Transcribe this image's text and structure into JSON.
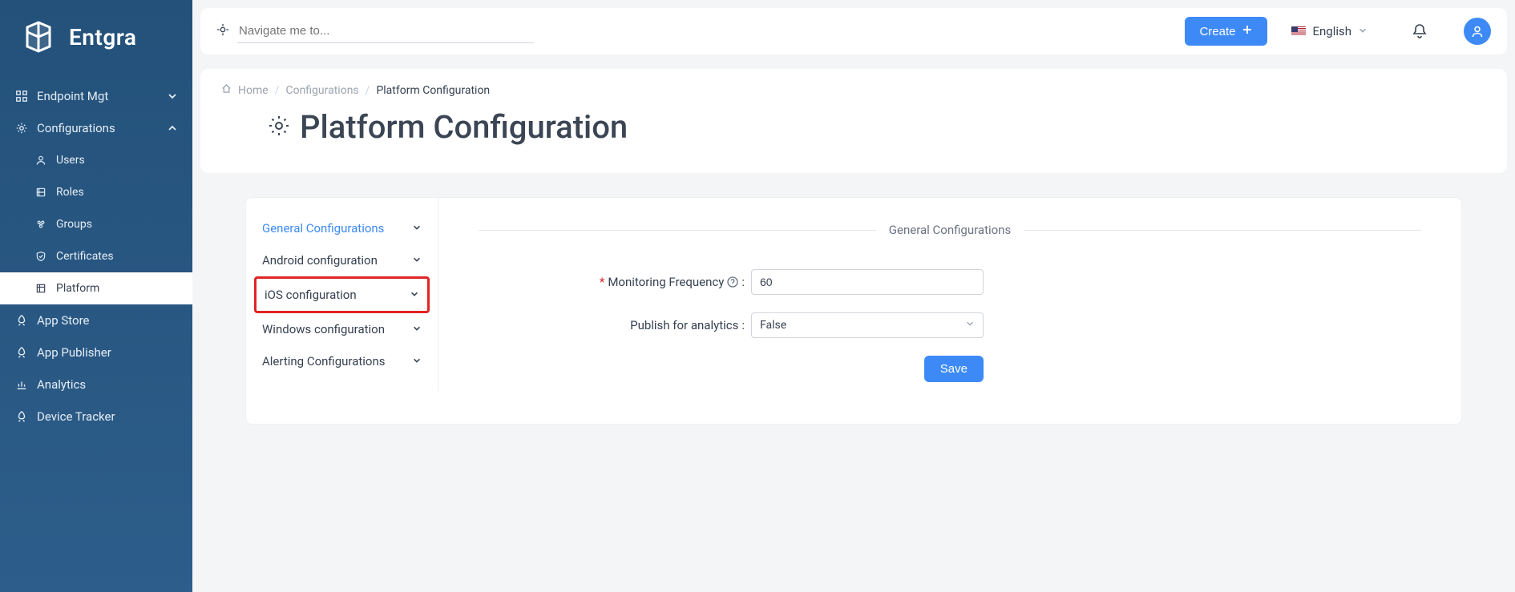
{
  "header": {
    "brand": "Entgra",
    "navPlaceholder": "Navigate me to...",
    "createLabel": "Create",
    "language": "English"
  },
  "sidebar": {
    "items": [
      {
        "label": "Endpoint Mgt",
        "expandable": true,
        "expanded": false
      },
      {
        "label": "Configurations",
        "expandable": true,
        "expanded": true
      }
    ],
    "configChildren": [
      {
        "label": "Users"
      },
      {
        "label": "Roles"
      },
      {
        "label": "Groups"
      },
      {
        "label": "Certificates"
      },
      {
        "label": "Platform",
        "active": true
      }
    ],
    "rest": [
      {
        "label": "App Store"
      },
      {
        "label": "App Publisher"
      },
      {
        "label": "Analytics"
      },
      {
        "label": "Device Tracker"
      }
    ]
  },
  "breadcrumb": {
    "home": "Home",
    "mid": "Configurations",
    "current": "Platform Configuration"
  },
  "page": {
    "title": "Platform Configuration"
  },
  "configNav": [
    {
      "label": "General Configurations",
      "active": true
    },
    {
      "label": "Android configuration"
    },
    {
      "label": "iOS configuration",
      "highlight": true
    },
    {
      "label": "Windows configuration"
    },
    {
      "label": "Alerting Configurations"
    }
  ],
  "form": {
    "sectionTitle": "General Configurations",
    "monitoringLabel": "Monitoring Frequency",
    "monitoringValue": "60",
    "publishLabel": "Publish for analytics",
    "publishValue": "False",
    "saveLabel": "Save"
  }
}
